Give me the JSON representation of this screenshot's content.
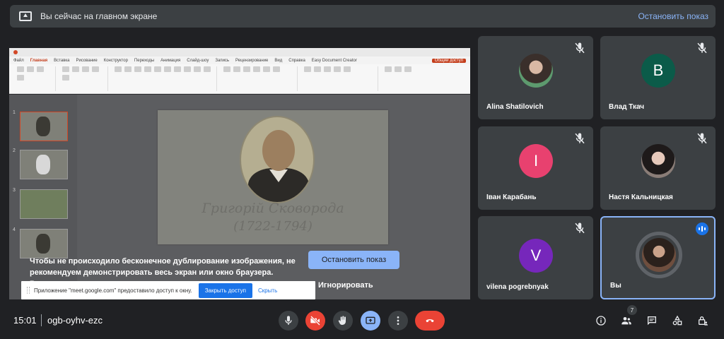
{
  "banner": {
    "title": "Вы сейчас на главном экране",
    "stop_label": "Остановить показ"
  },
  "share": {
    "ppt_tabs": [
      "Файл",
      "Главная",
      "Вставка",
      "Рисование",
      "Конструктор",
      "Переходы",
      "Анимация",
      "Слайд-шоу",
      "Запись",
      "Рецензирование",
      "Вид",
      "Справка",
      "Easy Document Creator"
    ],
    "ppt_share_label": "Общий доступ",
    "slide_name": "Григорій Сковорода",
    "slide_years": "(1722-1794)",
    "overlay_message": "Чтобы не происходило бесконечное дублирование изображения, не рекомендуем демонстрировать весь экран или окно браузера. Вместо",
    "overlay_stop_label": "Остановить показ",
    "overlay_ignore_label": "Игнорировать"
  },
  "infobar": {
    "text": "Приложение \"meet.google.com\" предоставило доступ к окну.",
    "close_label": "Закрыть доступ",
    "hide_label": "Скрыть"
  },
  "participants": [
    {
      "name": "Alina Shatilovich",
      "avatar": "photo",
      "muted": true
    },
    {
      "name": "Влад Ткач",
      "initial": "В",
      "color": "#0b5b49",
      "muted": true
    },
    {
      "name": "Іван Карабань",
      "initial": "І",
      "color": "#e8416f",
      "muted": true
    },
    {
      "name": "Настя Кальницкая",
      "avatar": "photo",
      "muted": true
    },
    {
      "name": "vilena pogrebnyak",
      "initial": "V",
      "color": "#7627bb",
      "muted": true
    },
    {
      "name": "Вы",
      "avatar": "photo",
      "speaking": true
    }
  ],
  "bottom": {
    "time": "15:01",
    "meeting_code": "ogb-oyhv-ezc",
    "participants_count": "7"
  },
  "colors": {
    "background": "#202124",
    "tile": "#3c4043",
    "accent": "#8ab4f8",
    "danger": "#ea4335"
  }
}
